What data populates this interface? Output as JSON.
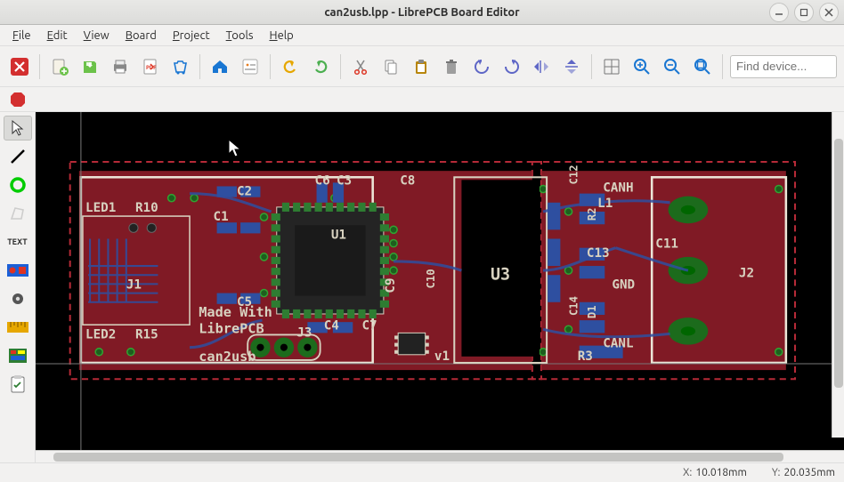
{
  "title": "can2usb.lpp - LibrePCB Board Editor",
  "menus": {
    "file": "File",
    "edit": "Edit",
    "view": "View",
    "board": "Board",
    "project": "Project",
    "tools": "Tools",
    "help": "Help"
  },
  "search": {
    "placeholder": "Find device..."
  },
  "status": {
    "x_label": "X:",
    "x_value": "10.018mm",
    "y_label": "Y:",
    "y_value": "20.035mm"
  },
  "tool_text_label": "TEXT",
  "board": {
    "silkscreen_labels": [
      "LED1",
      "R10",
      "LED2",
      "R15",
      "J1",
      "C2",
      "C1",
      "C5",
      "C6",
      "C3",
      "C8",
      "U1",
      "J3",
      "C4",
      "C7",
      "C9",
      "U3",
      "C12",
      "L1",
      "C13",
      "R2",
      "C11",
      "D1",
      "GND",
      "CANH",
      "CANL",
      "R3",
      "J2",
      "v1",
      "C14",
      "C10"
    ],
    "text_lines": [
      "Made With",
      "LibrePCB",
      "can2usb"
    ]
  }
}
